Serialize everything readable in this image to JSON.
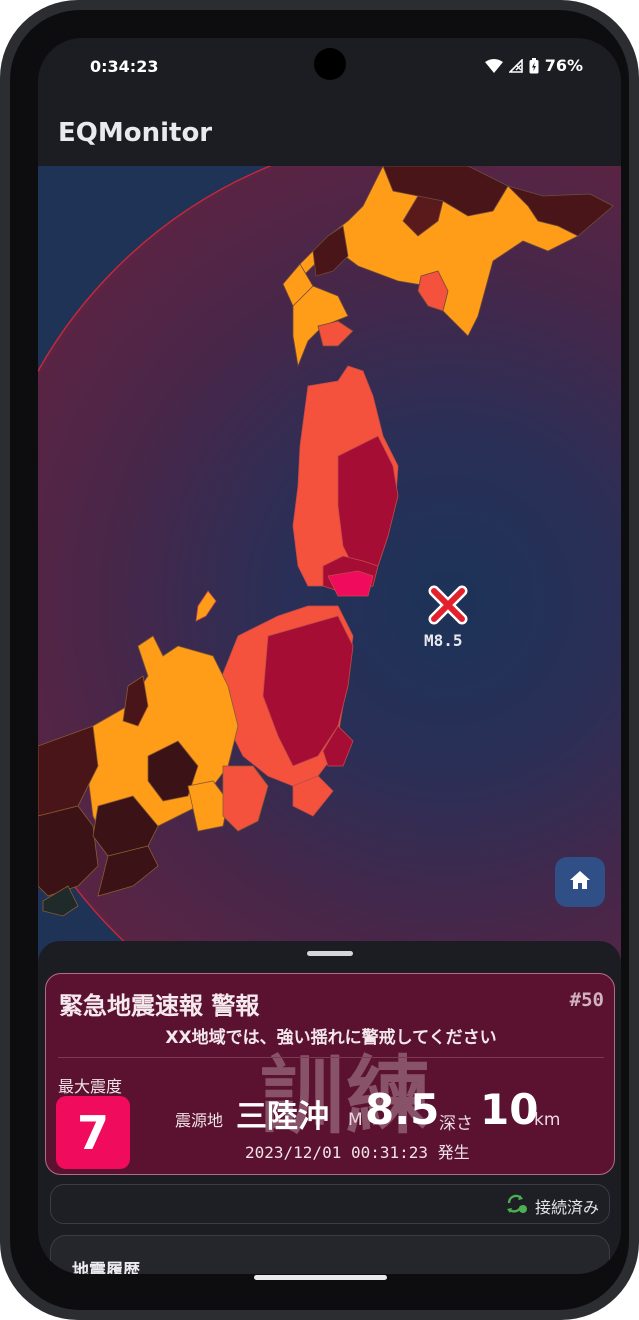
{
  "status_bar": {
    "time": "0:34:23",
    "battery_percent": "76%",
    "icons": [
      "wifi-icon",
      "cellular-no-signal-icon",
      "battery-charging-icon"
    ]
  },
  "app_bar": {
    "title": "EQMonitor"
  },
  "map": {
    "epicenter_label": "M8.5",
    "home_button_icon": "home-icon",
    "colors": {
      "ocean": "#1e3355",
      "intensity_7": "#f00b5c",
      "intensity_6_upper": "#a50d35",
      "intensity_6_lower": "#f4523d",
      "intensity_5_upper": "#ff9c18",
      "low_region": "#3b1215"
    }
  },
  "alert": {
    "title": "緊急地震速報 警報",
    "serial": "#50",
    "message": "XX地域では、強い揺れに警戒してください",
    "watermark": "訓練",
    "max_intensity_label": "最大震度",
    "max_intensity": "7",
    "hypocenter_label": "震源地",
    "hypocenter": "三陸沖",
    "magnitude_label": "M",
    "magnitude": "8.5",
    "depth_label": "深さ",
    "depth": "10",
    "depth_unit": "km",
    "origin_time": "2023/12/01 00:31:23 発生"
  },
  "connection": {
    "status": "接続済み"
  },
  "history": {
    "title": "地震履歴"
  }
}
